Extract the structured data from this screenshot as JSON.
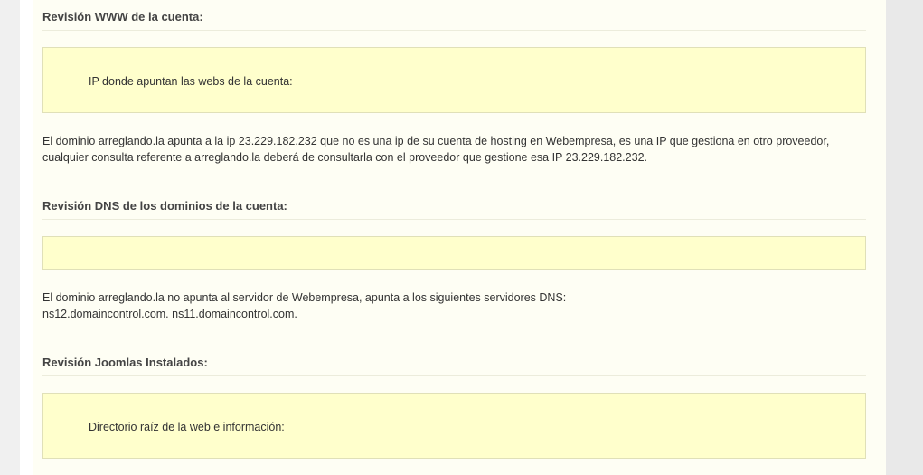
{
  "sections": {
    "www": {
      "heading": "Revisión WWW de la cuenta:",
      "box_label": "IP donde apuntan las webs de la cuenta:",
      "line1": "El dominio arreglando.la apunta a la ip 23.229.182.232 que no es una ip de su cuenta de hosting en Webempresa, es una IP que gestiona en otro proveedor,",
      "line2": "cualquier consulta referente a arreglando.la deberá de consultarla con el proveedor que gestione esa IP 23.229.182.232."
    },
    "dns": {
      "heading": "Revisión DNS de los dominios de la cuenta:",
      "line1": "El dominio arreglando.la no apunta al servidor de Webempresa, apunta a los siguientes servidores DNS:",
      "line2": "ns12.domaincontrol.com. ns11.domaincontrol.com."
    },
    "joomla": {
      "heading": "Revisión Joomlas Instalados:",
      "box_label": "Directorio raíz de la web e información:"
    }
  }
}
